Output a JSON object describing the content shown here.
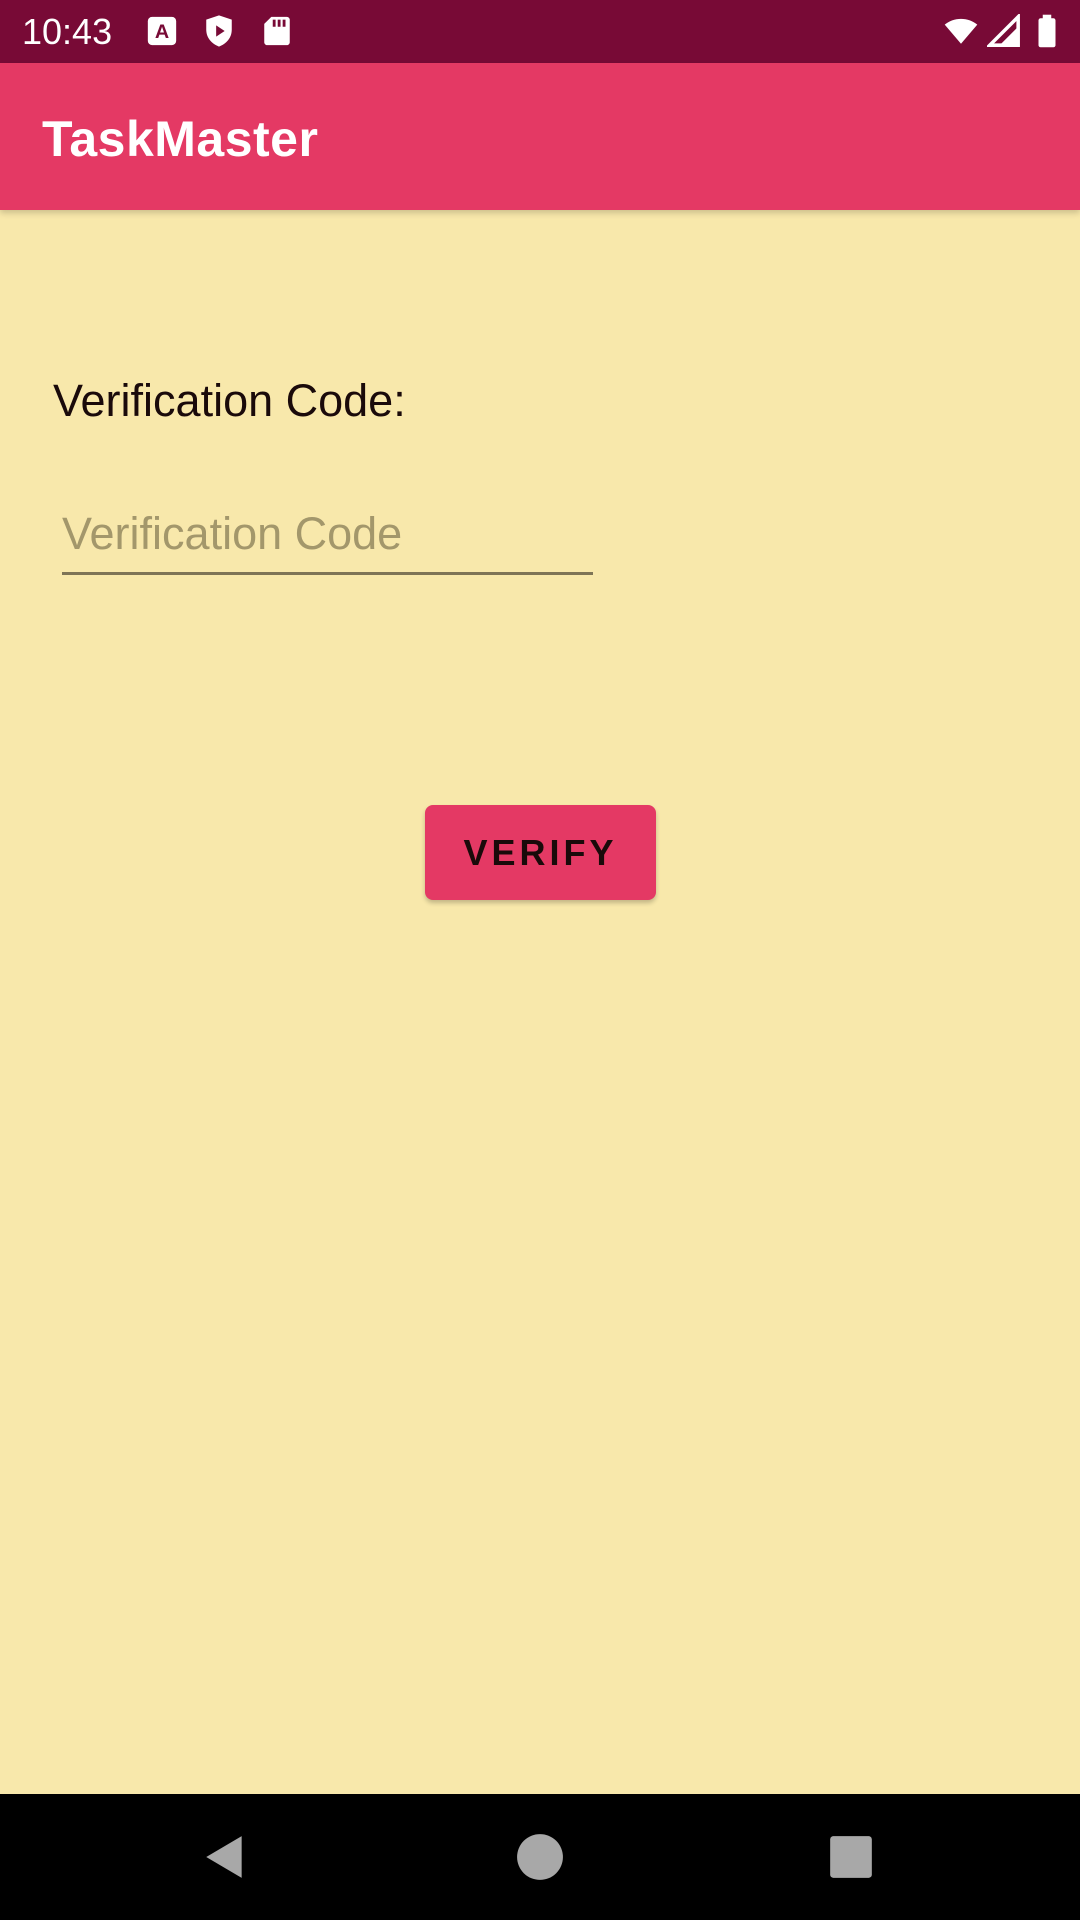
{
  "status_bar": {
    "time": "10:43",
    "icons": [
      "text-a-icon",
      "shield-play-icon",
      "sd-card-icon",
      "wifi-icon",
      "signal-icon",
      "battery-icon"
    ]
  },
  "app_bar": {
    "title": "TaskMaster"
  },
  "form": {
    "label": "Verification Code:",
    "code_input": {
      "value": "",
      "placeholder": "Verification Code"
    },
    "verify_label": "VERIFY"
  },
  "nav_bar": {
    "icons": [
      "back-icon",
      "home-icon",
      "recents-icon"
    ]
  },
  "colors": {
    "status_bar": "#780A36",
    "primary": "#E43964",
    "background": "#F8E8AB",
    "nav_bar": "#000000"
  }
}
